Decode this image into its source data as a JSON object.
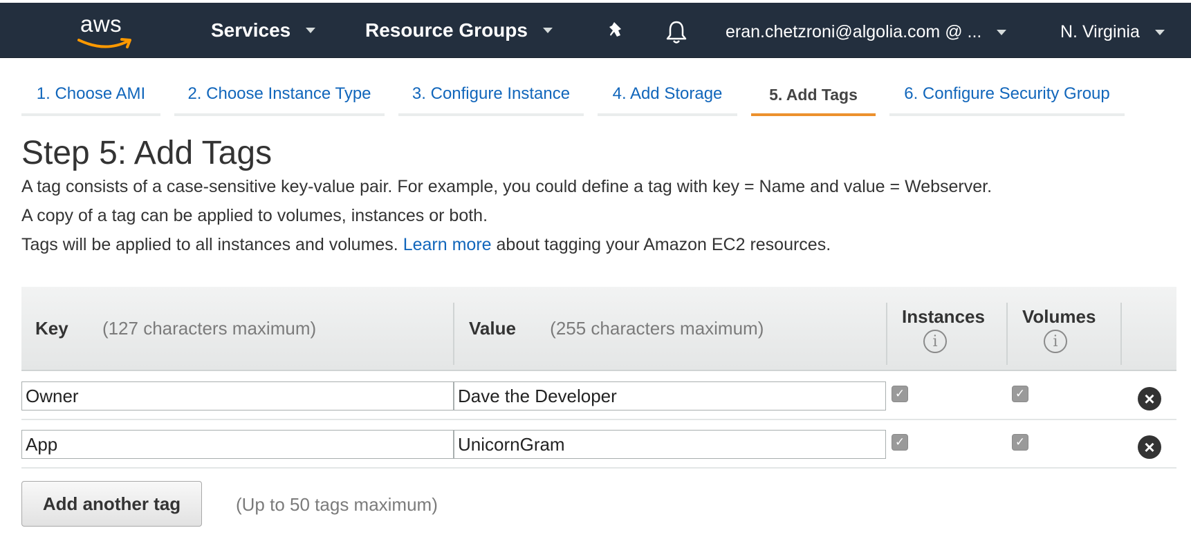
{
  "header": {
    "logo_text": "aws",
    "services_label": "Services",
    "resource_groups_label": "Resource Groups",
    "account_label": "eran.chetzroni@algolia.com @ ...",
    "region_label": "N. Virginia",
    "pin_icon": "pin-icon",
    "bell_icon": "bell-icon"
  },
  "wizard": {
    "tabs": [
      {
        "label": "1. Choose AMI",
        "active": false
      },
      {
        "label": "2. Choose Instance Type",
        "active": false
      },
      {
        "label": "3. Configure Instance",
        "active": false
      },
      {
        "label": "4. Add Storage",
        "active": false
      },
      {
        "label": "5. Add Tags",
        "active": true
      },
      {
        "label": "6. Configure Security Group",
        "active": false
      }
    ]
  },
  "page": {
    "title": "Step 5: Add Tags",
    "desc_line1": "A tag consists of a case-sensitive key-value pair. For example, you could define a tag with key = Name and value = Webserver.",
    "desc_line2": "A copy of a tag can be applied to volumes, instances or both.",
    "desc_line3_pre": "Tags will be applied to all instances and volumes.",
    "learn_more": "Learn more",
    "desc_line3_post": "about tagging your Amazon EC2 resources."
  },
  "table": {
    "key_header": "Key",
    "key_hint": "(127 characters maximum)",
    "value_header": "Value",
    "value_hint": "(255 characters maximum)",
    "instances_header": "Instances",
    "volumes_header": "Volumes",
    "rows": [
      {
        "key": "Owner",
        "value": "Dave the Developer",
        "instances": true,
        "volumes": true
      },
      {
        "key": "App",
        "value": "UnicornGram",
        "instances": true,
        "volumes": true
      }
    ]
  },
  "footer": {
    "add_button_label": "Add another tag",
    "add_hint": "(Up to 50 tags maximum)"
  },
  "colors": {
    "nav_bg": "#232f3e",
    "link": "#1166bb",
    "active_tab_underline": "#ec912d",
    "logo_smile": "#ff9900"
  }
}
